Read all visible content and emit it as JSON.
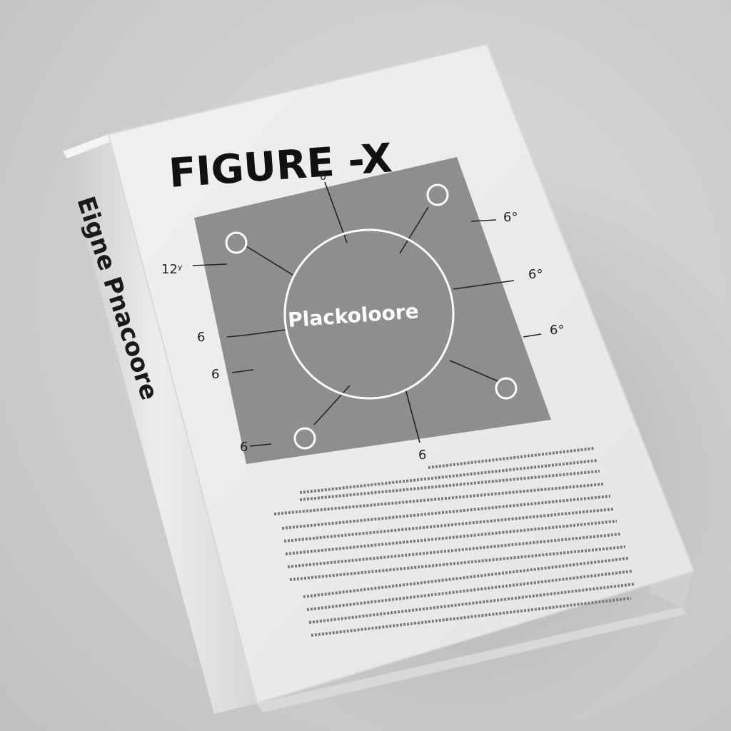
{
  "book": {
    "cover_title": "FIGURE -X",
    "spine_text": "Eigne Pnacoore",
    "figure": {
      "center_label": "Plackoloore",
      "callouts": [
        "12ʸ",
        "6",
        "6",
        "6°",
        "6°",
        "6°",
        "6",
        "6",
        "6"
      ]
    }
  },
  "colors": {
    "background": "#cbcdcc",
    "cover": "#ecedeb",
    "spine": "#e2e3e1",
    "figure_panel": "#8e8f8d",
    "title": "#111111"
  }
}
